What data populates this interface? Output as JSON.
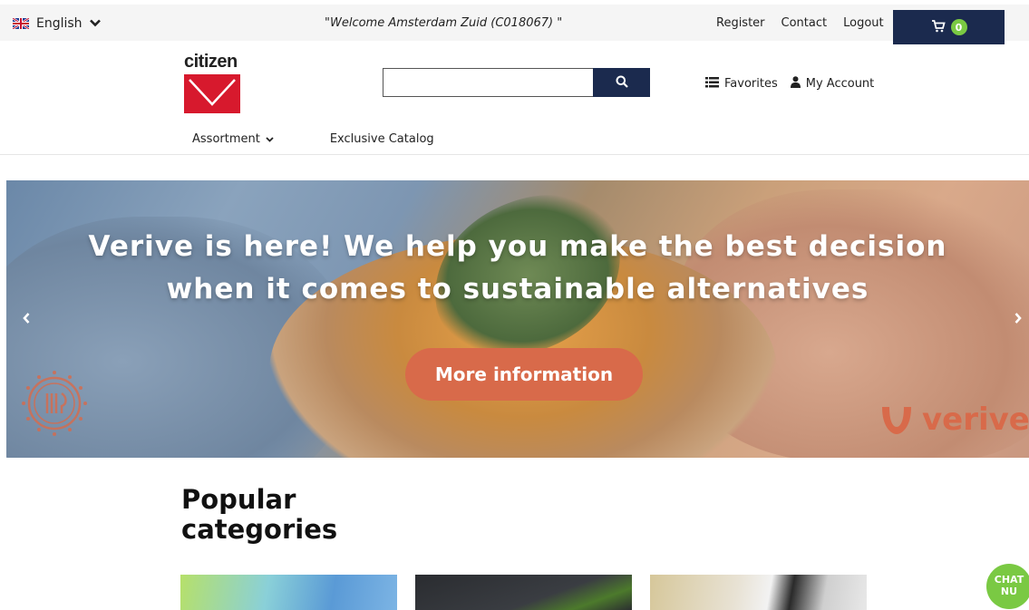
{
  "topbar": {
    "language": "English",
    "welcome": "\"Welcome Amsterdam Zuid (C018067) \"",
    "links": [
      "Register",
      "Contact",
      "Logout"
    ],
    "cart_count": "0"
  },
  "header": {
    "logo_text": "citizen",
    "search_placeholder": "",
    "favorites": "Favorites",
    "my_account": "My Account"
  },
  "nav": {
    "assortment": "Assortment",
    "exclusive": "Exclusive Catalog"
  },
  "banner": {
    "title_line1": "Verive is here! We help you make the best decision",
    "title_line2": "when it comes to sustainable alternatives",
    "button": "More information",
    "brand": "verive"
  },
  "popular": {
    "title_line1": "Popular",
    "title_line2": "categories"
  },
  "chat": {
    "line1": "CHAT",
    "line2": "NU"
  },
  "colors": {
    "navy": "#1b2a4e",
    "accent_orange": "#d86a4a",
    "green": "#7ac943",
    "brand_red": "#d7192d"
  }
}
